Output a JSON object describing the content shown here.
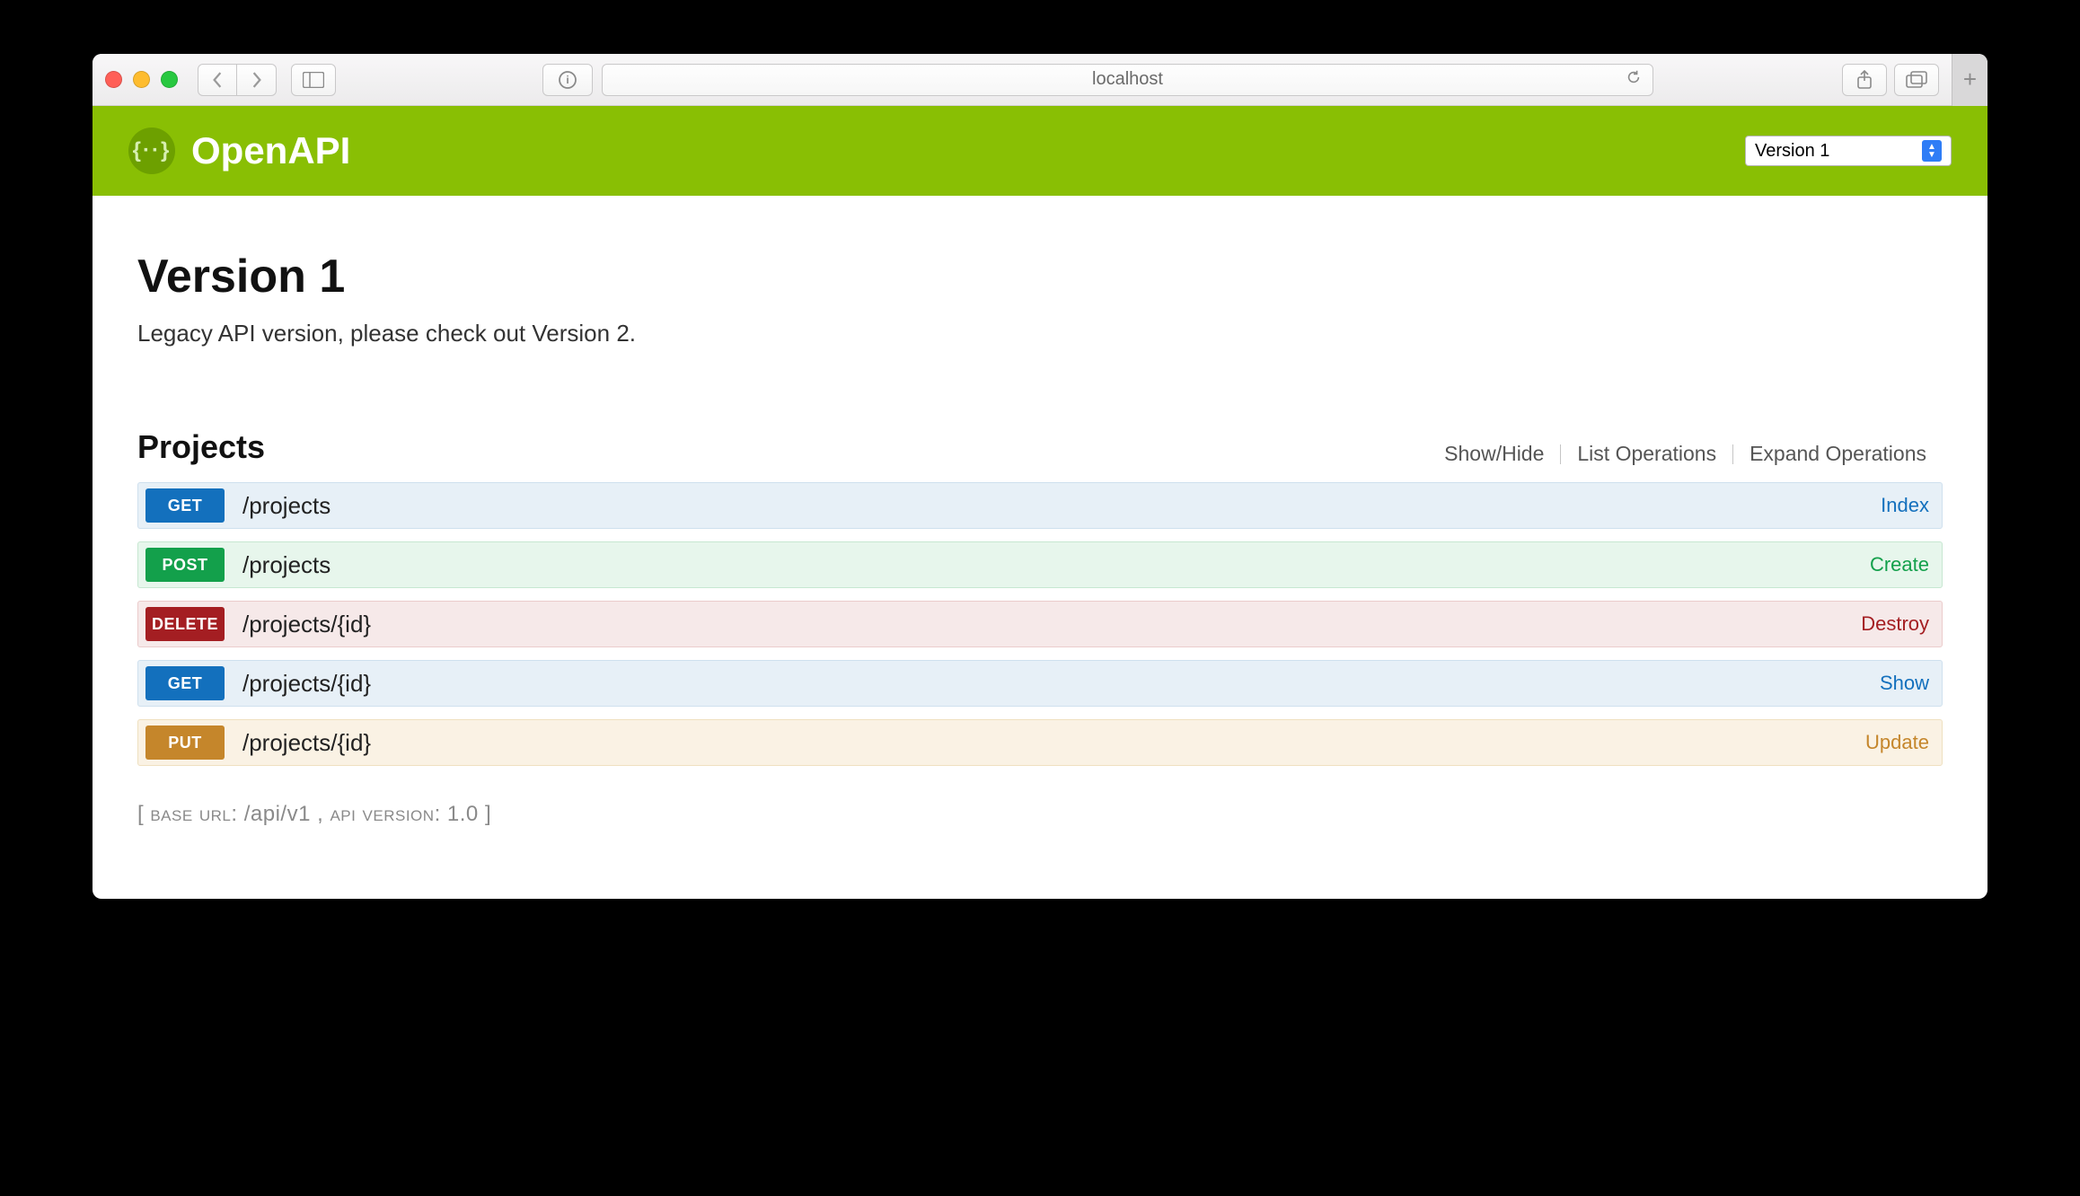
{
  "browser": {
    "address": "localhost"
  },
  "header": {
    "brand": "OpenAPI",
    "logo_glyph": "{··}",
    "version_selected": "Version 1"
  },
  "page": {
    "title": "Version 1",
    "subtitle": "Legacy API version, please check out Version 2."
  },
  "section": {
    "title": "Projects",
    "actions": {
      "show_hide": "Show/Hide",
      "list_ops": "List Operations",
      "expand_ops": "Expand Operations"
    }
  },
  "operations": [
    {
      "method": "GET",
      "path": "/projects",
      "action": "Index",
      "kind": "get"
    },
    {
      "method": "POST",
      "path": "/projects",
      "action": "Create",
      "kind": "post"
    },
    {
      "method": "DELETE",
      "path": "/projects/{id}",
      "action": "Destroy",
      "kind": "delete"
    },
    {
      "method": "GET",
      "path": "/projects/{id}",
      "action": "Show",
      "kind": "get"
    },
    {
      "method": "PUT",
      "path": "/projects/{id}",
      "action": "Update",
      "kind": "put"
    }
  ],
  "footer": {
    "base_url_label": "base url",
    "base_url": "/api/v1",
    "api_version_label": "api version",
    "api_version": "1.0"
  }
}
